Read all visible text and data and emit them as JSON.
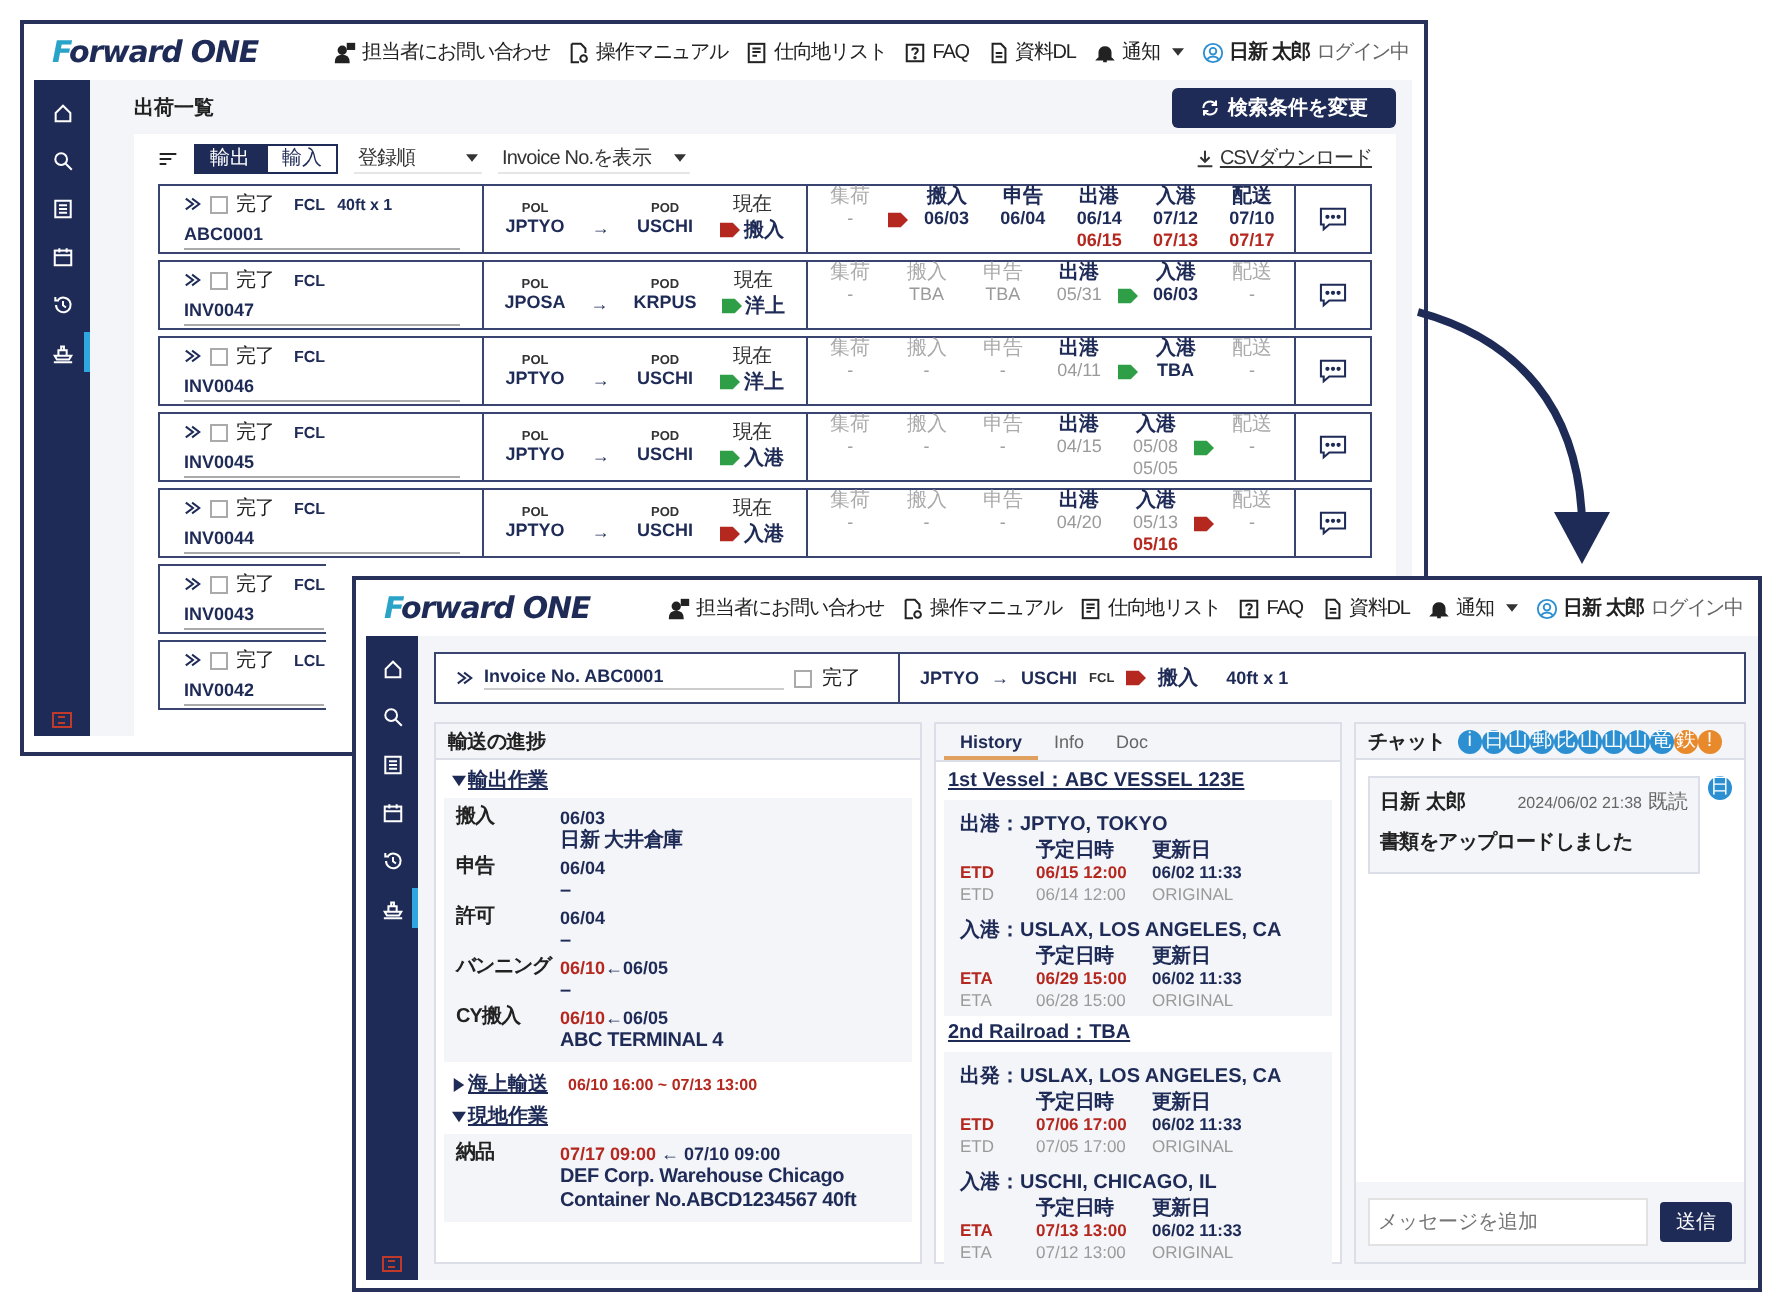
{
  "window_1": {
    "header": {
      "logo": "Forward ONE",
      "nav": [
        {
          "label": "担当者にお問い合わせ",
          "dropdown": false
        },
        {
          "label": "操作マニュアル",
          "dropdown": false
        },
        {
          "label": "仕向地リスト",
          "dropdown": false
        },
        {
          "label": "FAQ",
          "dropdown": false
        },
        {
          "label": "資料DL",
          "dropdown": false
        },
        {
          "label": "通知",
          "dropdown": true
        }
      ],
      "user": "日新 太郎",
      "user_status": "ログイン中"
    },
    "sidebar": [
      {
        "selected": false
      },
      {
        "selected": false
      },
      {
        "selected": false
      },
      {
        "selected": false
      },
      {
        "selected": false
      },
      {
        "selected": true
      }
    ],
    "page_title": "出荷一覧",
    "search_button": "検索条件を変更",
    "toolbar": {
      "direction_tabs": [
        {
          "label": "輸出",
          "selected": true
        },
        {
          "label": "輸入",
          "selected": false
        }
      ],
      "sort_select": "登録順",
      "display_select": "Invoice No.を表示",
      "csv_link": "CSVダウンロード"
    },
    "shipments": [
      {
        "checked": false,
        "done_label": "完了",
        "mode": "FCL",
        "size": "40ft x 1",
        "invoice": "ABC0001",
        "pol_label": "POL",
        "pol": "JPTYO",
        "arrow": "→",
        "pod_label": "POD",
        "pod": "USCHI",
        "status_label": "現在",
        "status": "搬入",
        "color": "#b5281f",
        "stages": [
          {
            "kind": "stage",
            "label": "集荷",
            "active": false,
            "lines": [
              {
                "text": "-",
                "kind": "pending"
              }
            ]
          },
          {
            "kind": "flag",
            "color": "#b5281f"
          },
          {
            "kind": "stage",
            "label": "搬入",
            "active": true,
            "lines": [
              {
                "text": "06/03",
                "kind": "actual"
              }
            ]
          },
          {
            "kind": "stage",
            "label": "申告",
            "active": true,
            "lines": [
              {
                "text": "06/04",
                "kind": "actual"
              }
            ]
          },
          {
            "kind": "stage",
            "label": "出港",
            "active": true,
            "lines": [
              {
                "text": "06/14",
                "kind": "actual"
              },
              {
                "text": "06/15",
                "kind": "revised"
              }
            ]
          },
          {
            "kind": "stage",
            "label": "入港",
            "active": true,
            "lines": [
              {
                "text": "07/12",
                "kind": "actual"
              },
              {
                "text": "07/13",
                "kind": "revised"
              }
            ]
          },
          {
            "kind": "stage",
            "label": "配送",
            "active": true,
            "lines": [
              {
                "text": "07/10",
                "kind": "actual"
              },
              {
                "text": "07/17",
                "kind": "revised"
              }
            ]
          }
        ]
      },
      {
        "checked": false,
        "done_label": "完了",
        "mode": "FCL",
        "invoice": "INV0047",
        "pol_label": "POL",
        "pol": "JPOSA",
        "arrow": "→",
        "pod_label": "POD",
        "pod": "KRPUS",
        "status_label": "現在",
        "status": "洋上",
        "color": "#2e9e47",
        "stages": [
          {
            "kind": "stage",
            "label": "集荷",
            "active": false,
            "lines": [
              {
                "text": "-",
                "kind": "pending"
              }
            ]
          },
          {
            "kind": "stage",
            "label": "搬入",
            "active": false,
            "lines": [
              {
                "text": "TBA",
                "kind": "pending"
              }
            ]
          },
          {
            "kind": "stage",
            "label": "申告",
            "active": false,
            "lines": [
              {
                "text": "TBA",
                "kind": "pending"
              }
            ]
          },
          {
            "kind": "stage",
            "label": "出港",
            "active": true,
            "lines": [
              {
                "text": "05/31",
                "kind": "pending"
              }
            ]
          },
          {
            "kind": "flag",
            "color": "#2e9e47"
          },
          {
            "kind": "stage",
            "label": "入港",
            "active": true,
            "lines": [
              {
                "text": "06/03",
                "kind": "actual"
              }
            ]
          },
          {
            "kind": "stage",
            "label": "配送",
            "active": false,
            "lines": [
              {
                "text": "-",
                "kind": "pending"
              }
            ]
          }
        ]
      },
      {
        "checked": false,
        "done_label": "完了",
        "mode": "FCL",
        "invoice": "INV0046",
        "pol_label": "POL",
        "pol": "JPTYO",
        "arrow": "→",
        "pod_label": "POD",
        "pod": "USCHI",
        "status_label": "現在",
        "status": "洋上",
        "color": "#2e9e47",
        "stages": [
          {
            "kind": "stage",
            "label": "集荷",
            "active": false,
            "lines": [
              {
                "text": "-",
                "kind": "pending"
              }
            ]
          },
          {
            "kind": "stage",
            "label": "搬入",
            "active": false,
            "lines": [
              {
                "text": "-",
                "kind": "pending"
              }
            ]
          },
          {
            "kind": "stage",
            "label": "申告",
            "active": false,
            "lines": [
              {
                "text": "-",
                "kind": "pending"
              }
            ]
          },
          {
            "kind": "stage",
            "label": "出港",
            "active": true,
            "lines": [
              {
                "text": "04/11",
                "kind": "pending"
              }
            ]
          },
          {
            "kind": "flag",
            "color": "#2e9e47"
          },
          {
            "kind": "stage",
            "label": "入港",
            "active": true,
            "lines": [
              {
                "text": "TBA",
                "kind": "actual"
              }
            ]
          },
          {
            "kind": "stage",
            "label": "配送",
            "active": false,
            "lines": [
              {
                "text": "-",
                "kind": "pending"
              }
            ]
          }
        ]
      },
      {
        "checked": false,
        "done_label": "完了",
        "mode": "FCL",
        "invoice": "INV0045",
        "pol_label": "POL",
        "pol": "JPTYO",
        "arrow": "→",
        "pod_label": "POD",
        "pod": "USCHI",
        "status_label": "現在",
        "status": "入港",
        "color": "#2e9e47",
        "stages": [
          {
            "kind": "stage",
            "label": "集荷",
            "active": false,
            "lines": [
              {
                "text": "-",
                "kind": "pending"
              }
            ]
          },
          {
            "kind": "stage",
            "label": "搬入",
            "active": false,
            "lines": [
              {
                "text": "-",
                "kind": "pending"
              }
            ]
          },
          {
            "kind": "stage",
            "label": "申告",
            "active": false,
            "lines": [
              {
                "text": "-",
                "kind": "pending"
              }
            ]
          },
          {
            "kind": "stage",
            "label": "出港",
            "active": true,
            "lines": [
              {
                "text": "04/15",
                "kind": "pending"
              }
            ]
          },
          {
            "kind": "stage",
            "label": "入港",
            "active": true,
            "lines": [
              {
                "text": "05/08",
                "kind": "pending"
              },
              {
                "text": "05/05",
                "kind": "pending"
              }
            ]
          },
          {
            "kind": "flag",
            "color": "#2e9e47"
          },
          {
            "kind": "stage",
            "label": "配送",
            "active": false,
            "lines": [
              {
                "text": "-",
                "kind": "pending"
              }
            ]
          }
        ]
      },
      {
        "checked": false,
        "done_label": "完了",
        "mode": "FCL",
        "invoice": "INV0044",
        "pol_label": "POL",
        "pol": "JPTYO",
        "arrow": "→",
        "pod_label": "POD",
        "pod": "USCHI",
        "status_label": "現在",
        "status": "入港",
        "color": "#b5281f",
        "stages": [
          {
            "kind": "stage",
            "label": "集荷",
            "active": false,
            "lines": [
              {
                "text": "-",
                "kind": "pending"
              }
            ]
          },
          {
            "kind": "stage",
            "label": "搬入",
            "active": false,
            "lines": [
              {
                "text": "-",
                "kind": "pending"
              }
            ]
          },
          {
            "kind": "stage",
            "label": "申告",
            "active": false,
            "lines": [
              {
                "text": "-",
                "kind": "pending"
              }
            ]
          },
          {
            "kind": "stage",
            "label": "出港",
            "active": true,
            "lines": [
              {
                "text": "04/20",
                "kind": "pending"
              }
            ]
          },
          {
            "kind": "stage",
            "label": "入港",
            "active": true,
            "lines": [
              {
                "text": "05/13",
                "kind": "pending"
              },
              {
                "text": "05/16",
                "kind": "revised"
              }
            ]
          },
          {
            "kind": "flag",
            "color": "#b5281f"
          },
          {
            "kind": "stage",
            "label": "配送",
            "active": false,
            "lines": [
              {
                "text": "-",
                "kind": "pending"
              }
            ]
          }
        ]
      },
      {
        "checked": false,
        "done_label": "完了",
        "mode": "FCL",
        "invoice": "INV0043"
      },
      {
        "checked": false,
        "done_label": "完了",
        "mode": "LCL",
        "invoice": "INV0042"
      }
    ]
  },
  "window_2": {
    "header": {
      "logo": "Forward ONE",
      "nav": [
        {
          "label": "担当者にお問い合わせ",
          "dropdown": false
        },
        {
          "label": "操作マニュアル",
          "dropdown": false
        },
        {
          "label": "仕向地リスト",
          "dropdown": false
        },
        {
          "label": "FAQ",
          "dropdown": false
        },
        {
          "label": "資料DL",
          "dropdown": false
        },
        {
          "label": "通知",
          "dropdown": true
        }
      ],
      "user": "日新 太郎",
      "user_status": "ログイン中"
    },
    "sidebar": [
      {
        "selected": false
      },
      {
        "selected": false
      },
      {
        "selected": false
      },
      {
        "selected": false
      },
      {
        "selected": false
      },
      {
        "selected": true
      }
    ],
    "invoice_bar": {
      "invoice": "Invoice No. ABC0001",
      "checked": false,
      "done_label": "完了",
      "pol": "JPTYO",
      "arrow": "→",
      "pod": "USCHI",
      "mode": "FCL",
      "status": "搬入",
      "color": "#b5281f",
      "size": "40ft x 1"
    },
    "progress": {
      "title": "輸送の進捗",
      "sections": [
        {
          "title": "輸出作業",
          "expanded": true,
          "events": [
            {
              "label": "搬入",
              "dates": [
                {
                  "text": "06/03",
                  "kind": "actual"
                }
              ],
              "notes": [
                "日新 大井倉庫"
              ]
            },
            {
              "label": "申告",
              "dates": [
                {
                  "text": "06/04",
                  "kind": "actual"
                }
              ],
              "notes": [
                "–"
              ]
            },
            {
              "label": "許可",
              "dates": [
                {
                  "text": "06/04",
                  "kind": "actual"
                }
              ],
              "notes": [
                "–"
              ]
            },
            {
              "label": "バンニング",
              "dates": [
                {
                  "text": "06/10",
                  "kind": "revised"
                },
                {
                  "text": "←06/05",
                  "kind": "actual"
                }
              ],
              "notes": [
                "–"
              ]
            },
            {
              "label": "CY搬入",
              "dates": [
                {
                  "text": "06/10",
                  "kind": "revised"
                },
                {
                  "text": "←06/05",
                  "kind": "actual"
                }
              ],
              "notes": [
                "ABC TERMINAL 4"
              ]
            }
          ]
        },
        {
          "title": "海上輸送",
          "expanded": false,
          "summary": "06/10 16:00 ~ 07/13 13:00"
        },
        {
          "title": "現地作業",
          "expanded": true,
          "events": [
            {
              "label": "納品",
              "dates": [
                {
                  "text": "07/17 09:00",
                  "kind": "revised"
                },
                {
                  "text": " ← 07/10 09:00",
                  "kind": "actual"
                }
              ],
              "notes": [
                "DEF Corp. Warehouse Chicago",
                "Container No.ABCD1234567 40ft"
              ]
            }
          ]
        }
      ]
    },
    "schedule": {
      "tabs": [
        {
          "label": "History",
          "selected": true
        },
        {
          "label": "Info",
          "selected": false
        },
        {
          "label": "Doc",
          "selected": false
        }
      ],
      "legs": [
        {
          "title": "1st Vessel：ABC VESSEL 123E",
          "stops": [
            {
              "title": "出港：JPTYO, TOKYO",
              "col_1": "予定日時",
              "col_2": "更新日",
              "rows": [
                {
                  "code": "ETD",
                  "planned": "06/15 12:00",
                  "updated": "06/02 11:33",
                  "latest": true
                },
                {
                  "code": "ETD",
                  "planned": "06/14 12:00",
                  "updated": "ORIGINAL",
                  "latest": false
                }
              ]
            },
            {
              "title": "入港：USLAX, LOS ANGELES, CA",
              "col_1": "予定日時",
              "col_2": "更新日",
              "rows": [
                {
                  "code": "ETA",
                  "planned": "06/29 15:00",
                  "updated": "06/02 11:33",
                  "latest": true
                },
                {
                  "code": "ETA",
                  "planned": "06/28 15:00",
                  "updated": "ORIGINAL",
                  "latest": false
                }
              ]
            }
          ]
        },
        {
          "title": "2nd Railroad：TBA",
          "stops": [
            {
              "title": "出発：USLAX, LOS ANGELES, CA",
              "col_1": "予定日時",
              "col_2": "更新日",
              "rows": [
                {
                  "code": "ETD",
                  "planned": "07/06 17:00",
                  "updated": "06/02 11:33",
                  "latest": true
                },
                {
                  "code": "ETD",
                  "planned": "07/05 17:00",
                  "updated": "ORIGINAL",
                  "latest": false
                }
              ]
            },
            {
              "title": "入港：USCHI, CHICAGO, IL",
              "col_1": "予定日時",
              "col_2": "更新日",
              "rows": [
                {
                  "code": "ETA",
                  "planned": "07/13 13:00",
                  "updated": "06/02 11:33",
                  "latest": true
                },
                {
                  "code": "ETA",
                  "planned": "07/12 13:00",
                  "updated": "ORIGINAL",
                  "latest": false
                }
              ]
            }
          ]
        }
      ]
    },
    "chat": {
      "title": "チャット",
      "members": [
        {
          "initial": "i",
          "color": "#2b8fd1"
        },
        {
          "initial": "日",
          "color": "#2b8fd1"
        },
        {
          "initial": "山",
          "color": "#2b8fd1"
        },
        {
          "initial": "郵",
          "color": "#2b8fd1"
        },
        {
          "initial": "比",
          "color": "#2b8fd1"
        },
        {
          "initial": "山",
          "color": "#2b8fd1"
        },
        {
          "initial": "山",
          "color": "#2b8fd1"
        },
        {
          "initial": "山",
          "color": "#2b8fd1"
        },
        {
          "initial": "竜",
          "color": "#2b8fd1"
        },
        {
          "initial": "鉄",
          "color": "#e8892b"
        },
        {
          "initial": "!",
          "color": "#e8892b"
        }
      ],
      "messages": [
        {
          "author": "日新 太郎",
          "time": "2024/06/02 21:38",
          "read": "既読",
          "text": "書類をアップロードしました",
          "avatar": "日",
          "color": "#2b8fd1"
        }
      ],
      "input_placeholder": "メッセージを追加",
      "send_button": "送信"
    }
  }
}
